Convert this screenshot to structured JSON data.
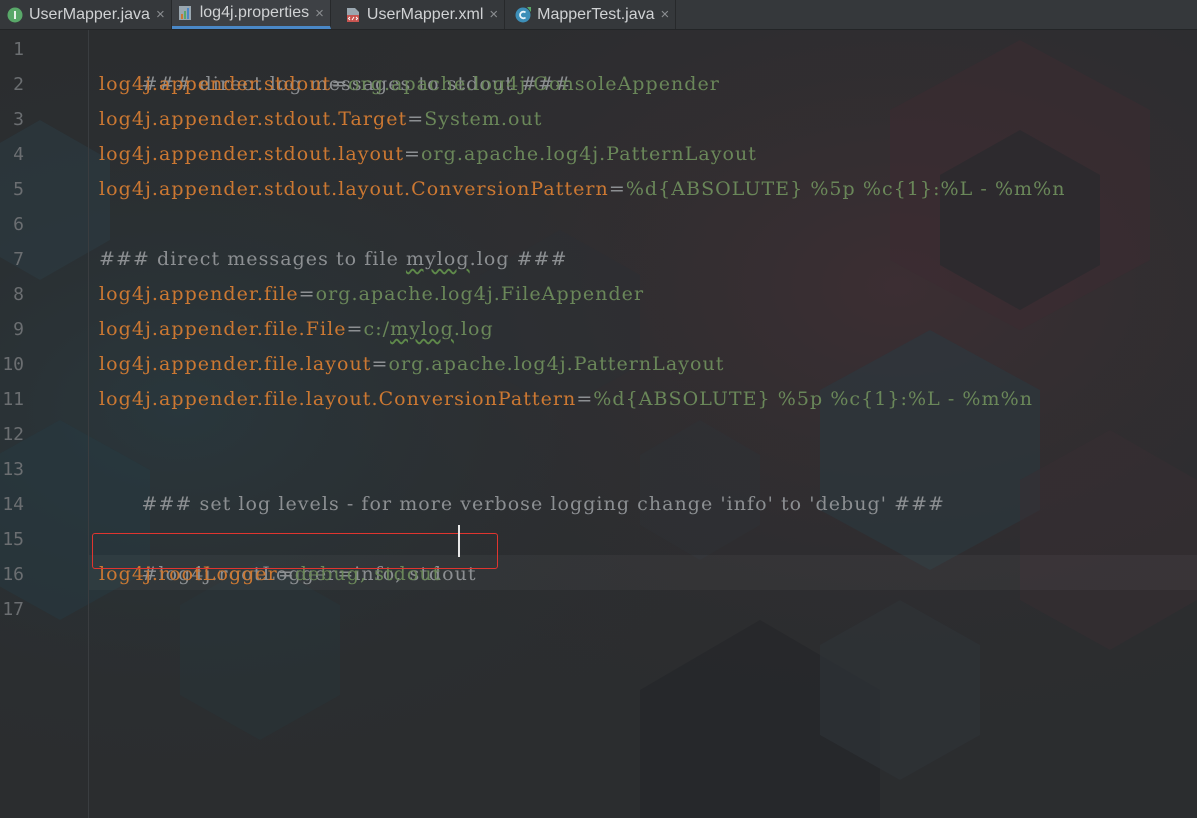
{
  "tabs": [
    {
      "label": "UserMapper.java",
      "icon": "interface-icon",
      "active": false
    },
    {
      "label": "log4j.properties",
      "icon": "properties-file-icon",
      "active": true
    },
    {
      "label": "UserMapper.xml",
      "icon": "xml-file-icon",
      "active": false
    },
    {
      "label": "MapperTest.java",
      "icon": "class-icon",
      "active": false
    }
  ],
  "close_glyph": "×",
  "line_numbers": [
    "1",
    "2",
    "3",
    "4",
    "5",
    "6",
    "7",
    "8",
    "9",
    "10",
    "11",
    "12",
    "13",
    "14",
    "15",
    "16",
    "17"
  ],
  "code": {
    "l1": "### direct log messages to stdout ###",
    "l2k": "log4j.appender.stdout",
    "l2v": "org.apache.log4j.ConsoleAppender",
    "l3k": "log4j.appender.stdout.Target",
    "l3v": "System.out",
    "l4k": "log4j.appender.stdout.layout",
    "l4v": "org.apache.log4j.PatternLayout",
    "l5k": "log4j.appender.stdout.layout.ConversionPattern",
    "l5v": "%d{ABSOLUTE} %5p %c{1}:%L - %m%n",
    "l7a": "### direct messages to file ",
    "l7b": "mylog",
    "l7c": ".log ###",
    "l8k": "log4j.appender.file",
    "l8v": "org.apache.log4j.FileAppender",
    "l9k": "log4j.appender.file.File",
    "l9a": "c:/",
    "l9b": "mylog",
    "l9c": ".log",
    "l10k": "log4j.appender.file.layout",
    "l10v": "org.apache.log4j.PatternLayout",
    "l11k": "log4j.appender.file.layout.ConversionPattern",
    "l11v": "%d{ABSOLUTE} %5p %c{1}:%L - %m%n",
    "l13": "### set log levels - for more verbose logging change 'info' to 'debug' ###",
    "l15": "#log4j.rootLogger=info, stdout",
    "l16k": "log4j.rootLogger",
    "l16v": "debug, stdout",
    "eq": "="
  },
  "colors": {
    "key": "#cc7832",
    "value": "#6a8759",
    "comment": "#8c8f92",
    "highlight_box": "#e0352f",
    "active_tab_underline": "#4a88c7"
  }
}
